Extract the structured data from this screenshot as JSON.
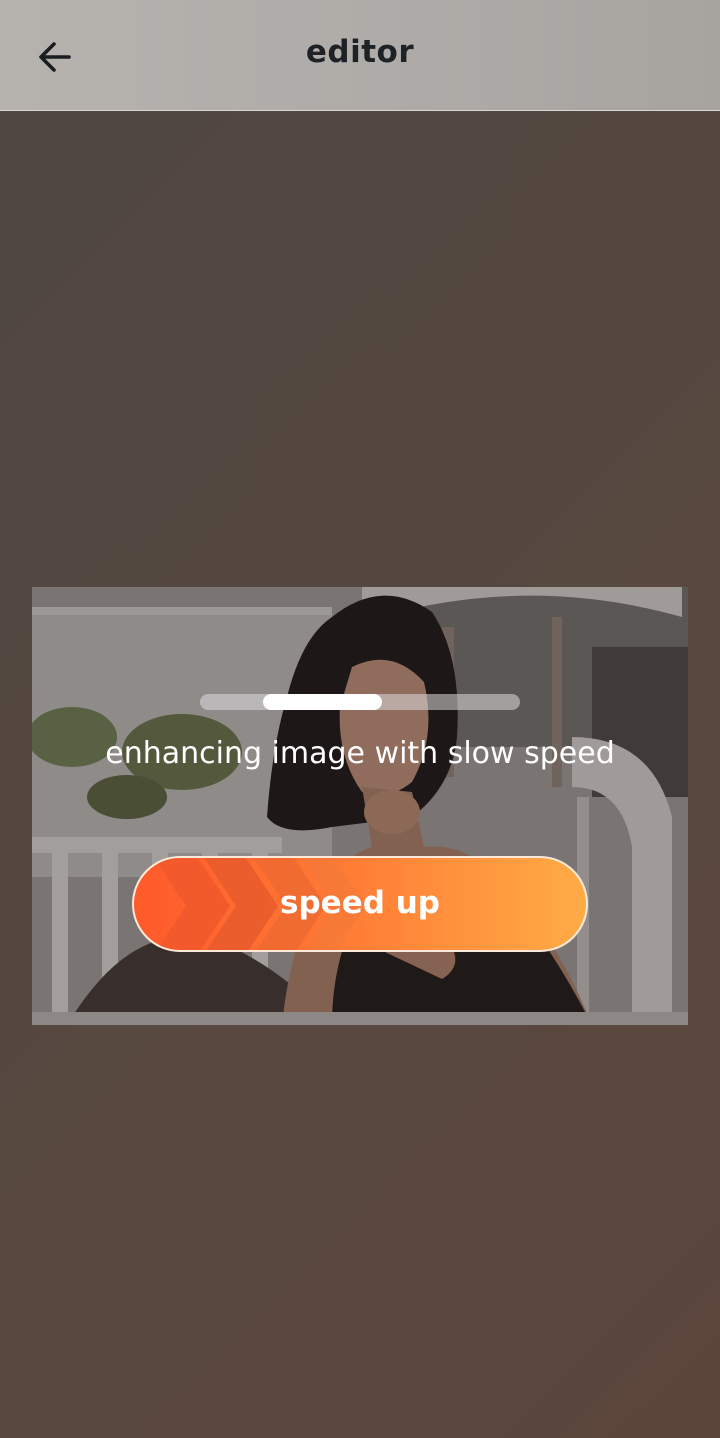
{
  "header": {
    "title": "editor",
    "back_icon": "arrow-left-icon"
  },
  "overlay": {
    "progress_fraction": 0.37,
    "status_text": "enhancing image with slow speed"
  },
  "speed_button": {
    "label": "speed up",
    "icon": "chevrons-right-icon",
    "gradient_start": "#ff5a2b",
    "gradient_end": "#ffac45"
  },
  "colors": {
    "appbar": "#b2aeaa",
    "background": "#544842",
    "progress_fill": "#ffffff"
  }
}
